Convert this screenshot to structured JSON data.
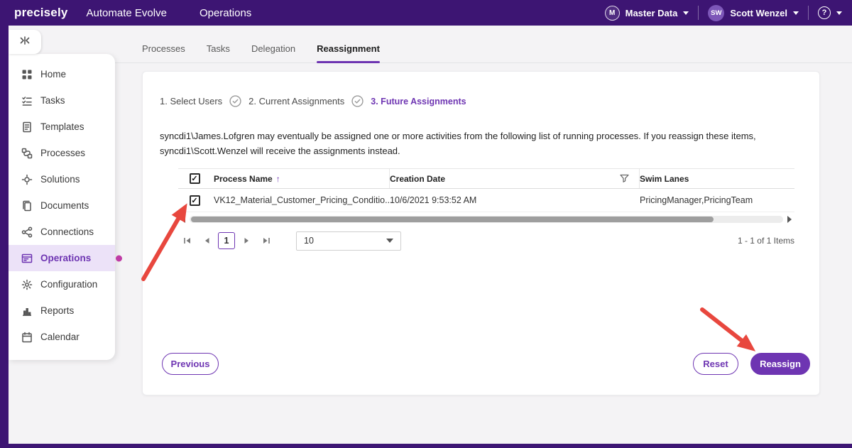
{
  "topbar": {
    "logo": "precisely",
    "product": "Automate Evolve",
    "section": "Operations",
    "master_data": {
      "initial": "M",
      "label": "Master Data"
    },
    "user": {
      "initials": "SW",
      "name": "Scott Wenzel"
    },
    "help": "?"
  },
  "sidebar": {
    "items": [
      {
        "label": "Home"
      },
      {
        "label": "Tasks"
      },
      {
        "label": "Templates"
      },
      {
        "label": "Processes"
      },
      {
        "label": "Solutions"
      },
      {
        "label": "Documents"
      },
      {
        "label": "Connections"
      },
      {
        "label": "Operations",
        "selected": true
      },
      {
        "label": "Configuration"
      },
      {
        "label": "Reports"
      },
      {
        "label": "Calendar"
      }
    ]
  },
  "tabs": [
    {
      "label": "Processes"
    },
    {
      "label": "Tasks"
    },
    {
      "label": "Delegation"
    },
    {
      "label": "Reassignment",
      "active": true
    }
  ],
  "wizard": {
    "steps": [
      {
        "label": "1. Select Users",
        "status": "done"
      },
      {
        "label": "2. Current Assignments",
        "status": "done"
      },
      {
        "label": "3. Future Assignments",
        "status": "active"
      }
    ]
  },
  "description": "syncdi1\\James.Lofgren may eventually be assigned one or more activities from the following list of running processes. If you reassign these items, syncdi1\\Scott.Wenzel will receive the assignments instead.",
  "table": {
    "columns": [
      "Process Name",
      "Creation Date",
      "Swim Lanes"
    ],
    "rows": [
      {
        "checked": true,
        "process_name": "VK12_Material_Customer_Pricing_Conditio...",
        "creation_date": "10/6/2021 9:53:52 AM",
        "swim_lanes": "PricingManager,PricingTeam"
      }
    ]
  },
  "pagination": {
    "current_page": "1",
    "page_size": "10",
    "range_label": "1 - 1 of 1 Items"
  },
  "buttons": {
    "previous": "Previous",
    "reset": "Reset",
    "reassign": "Reassign"
  },
  "colors": {
    "brand_purple": "#3d1573",
    "accent_purple": "#6e35b2",
    "selected_item_bg": "#ece2f8",
    "annotation_red": "#e8473e",
    "annotation_dot": "#bf3ba5"
  }
}
